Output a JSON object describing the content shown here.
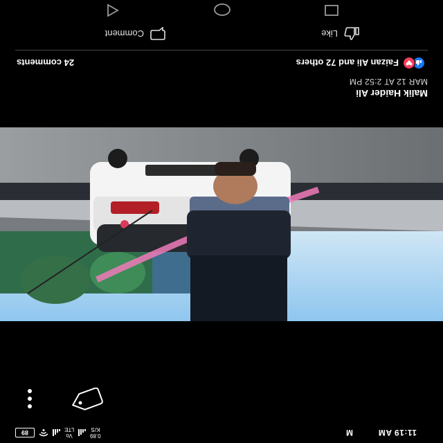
{
  "status_bar": {
    "time": "11:19 AM",
    "carrier_indicator": "M",
    "network_type": "LTE",
    "volte": "Vo",
    "speed_value": "0.89",
    "speed_unit": "K/S",
    "battery": "89"
  },
  "post": {
    "author": "Malik Haider Ali",
    "timestamp": "MAR 12 AT 2:52 PM"
  },
  "reactions": {
    "summary": "Faizan Ali and 72 others",
    "icons": [
      "like-icon",
      "love-icon"
    ],
    "like_color": "#1877f2",
    "love_color": "#f33e58"
  },
  "comments_count": "24 comments",
  "actions": {
    "like_label": "Like",
    "comment_label": "Comment"
  },
  "icons": {
    "tag": "tag-icon",
    "more": "more-vertical-icon",
    "back": "back-triangle-icon",
    "home": "home-circle-icon",
    "recents": "recents-square-icon"
  },
  "orientation": "rotated 180 degrees"
}
